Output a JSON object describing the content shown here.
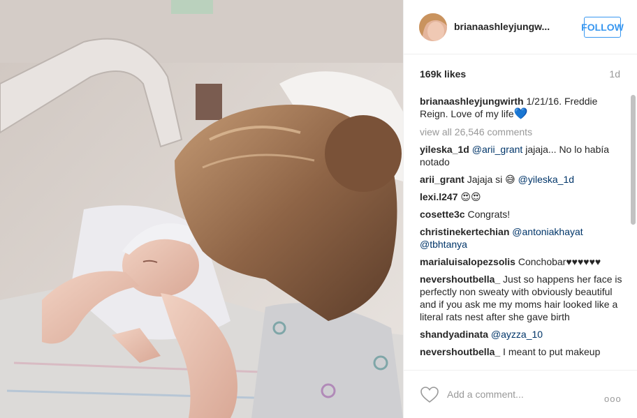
{
  "post": {
    "username": "brianaashleyjungw...",
    "follow_label": "FOLLOW",
    "likes": "169k likes",
    "time": "1d"
  },
  "comments": [
    {
      "user": "brianaashleyjungwirth",
      "text": "1/21/16. Freddie Reign. Love of my life",
      "emoji": "💙"
    },
    {
      "view_all": "view all 26,546 comments"
    },
    {
      "user": "yileska_1d",
      "mention": "@arii_grant",
      "text": " jajaja... No lo había notado"
    },
    {
      "user": "arii_grant",
      "text": "Jajaja si ",
      "emoji": "😅",
      "mention": " @yileska_1d"
    },
    {
      "user": "lexi.l247",
      "emoji": "😍😍"
    },
    {
      "user": "cosette3c",
      "text": "Congrats!"
    },
    {
      "user": "christinekertechian",
      "mention": "@antoniakhayat @tbhtanya"
    },
    {
      "user": "marialuisalopezsolis",
      "text": "Conchobar♥♥♥♥♥♥"
    },
    {
      "user": "nevershoutbella_",
      "text": "Just so happens her face is perfectly non sweaty with obviously beautiful and if you ask me my moms hair looked like a literal rats nest after she gave birth"
    },
    {
      "user": "shandyadinata",
      "mention": "@ayzza_10"
    },
    {
      "user": "nevershoutbella_",
      "text": "I meant to put makeup"
    }
  ],
  "footer": {
    "add_comment_placeholder": "Add a comment...",
    "more_icon": "ooo"
  },
  "colors": {
    "accent": "#3897f0",
    "text": "#262626",
    "muted": "#999999",
    "mention": "#003569"
  },
  "icons": {
    "like": "heart-outline-icon",
    "more": "ellipsis-icon"
  }
}
